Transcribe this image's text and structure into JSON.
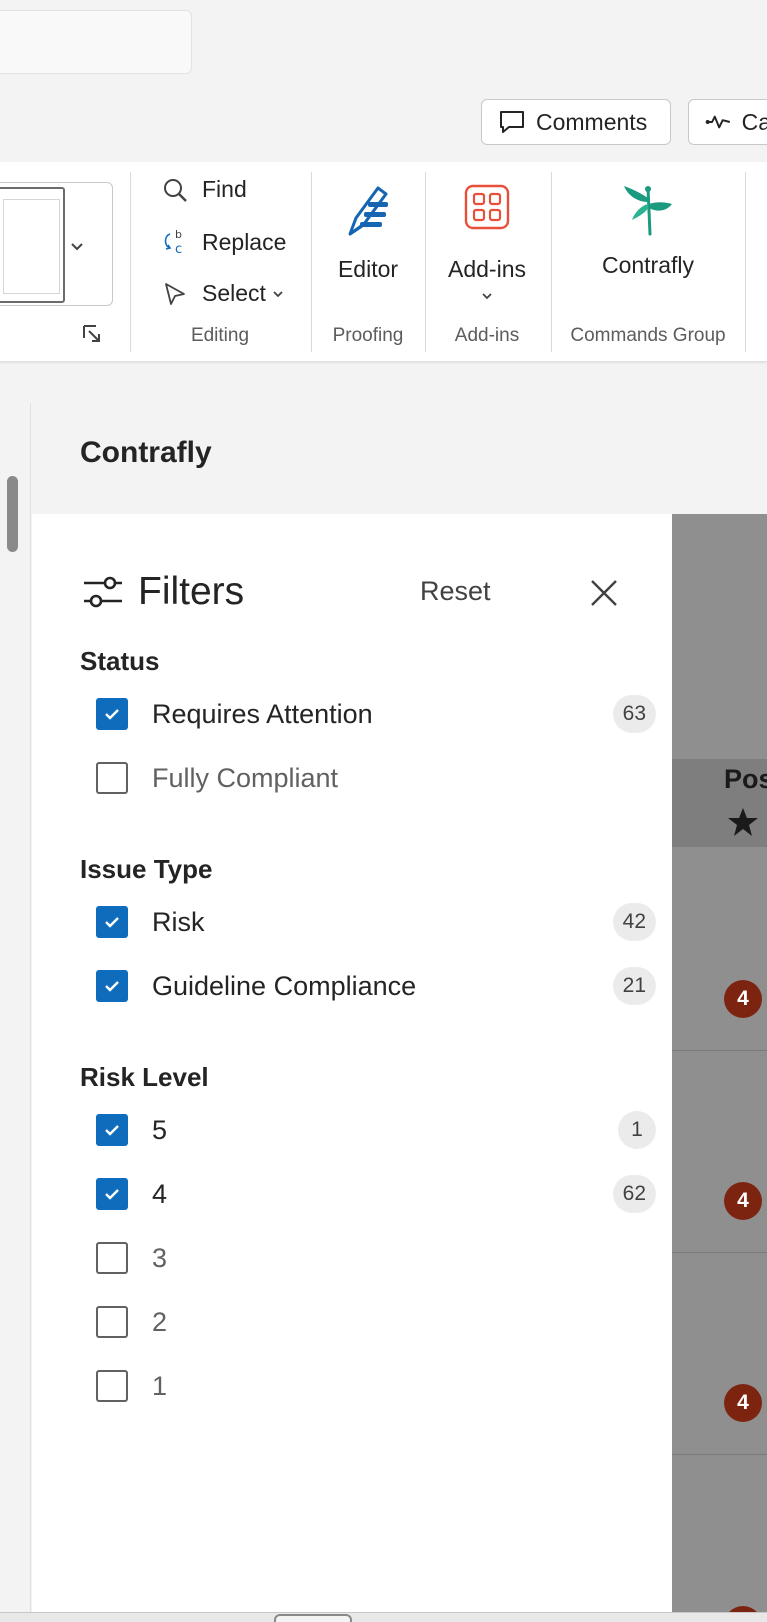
{
  "header": {
    "comments_label": "Comments",
    "catchup_label": "Ca"
  },
  "ribbon": {
    "editing": {
      "find_label": "Find",
      "replace_label": "Replace",
      "select_label": "Select",
      "group_label": "Editing"
    },
    "proofing": {
      "editor_label": "Editor",
      "group_label": "Proofing"
    },
    "addins": {
      "addins_label": "Add-ins",
      "group_label": "Add-ins"
    },
    "commands": {
      "contrafly_label": "Contrafly",
      "group_label": "Commands Group"
    }
  },
  "pane": {
    "title": "Contrafly",
    "background_column_header": "Pos",
    "risk_badges": [
      "4",
      "4",
      "4"
    ]
  },
  "filters": {
    "title": "Filters",
    "reset_label": "Reset",
    "sections": [
      {
        "title": "Status",
        "options": [
          {
            "label": "Requires Attention",
            "checked": true,
            "count": "63"
          },
          {
            "label": "Fully Compliant",
            "checked": false,
            "count": ""
          }
        ]
      },
      {
        "title": "Issue Type",
        "options": [
          {
            "label": "Risk",
            "checked": true,
            "count": "42"
          },
          {
            "label": "Guideline Compliance",
            "checked": true,
            "count": "21"
          }
        ]
      },
      {
        "title": "Risk Level",
        "options": [
          {
            "label": "5",
            "checked": true,
            "count": "1"
          },
          {
            "label": "4",
            "checked": true,
            "count": "62"
          },
          {
            "label": "3",
            "checked": false,
            "count": ""
          },
          {
            "label": "2",
            "checked": false,
            "count": ""
          },
          {
            "label": "1",
            "checked": false,
            "count": ""
          }
        ]
      }
    ]
  },
  "colors": {
    "checkbox_checked": "#0f6cbd",
    "risk_badge": "#7d2410",
    "editor_icon": "#1565b3",
    "addins_icon": "#e8503a",
    "contrafly_icon": "#1a9a7e"
  }
}
